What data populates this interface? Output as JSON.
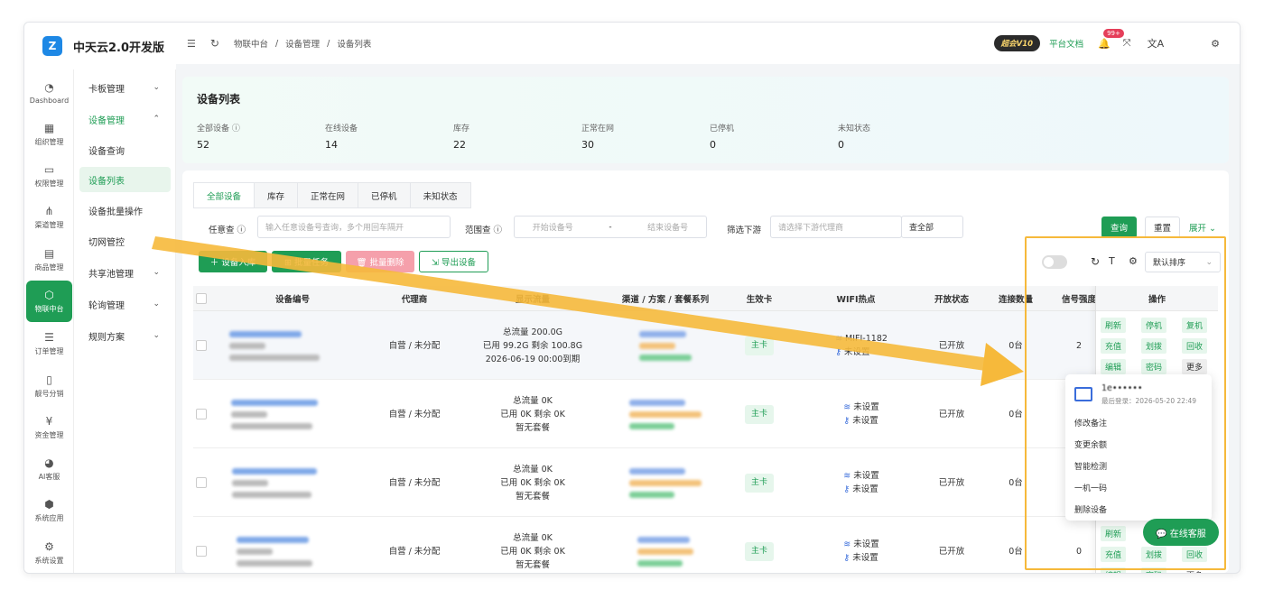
{
  "app": {
    "title": "中天云2.0开发版",
    "logo": "Z"
  },
  "rail": [
    {
      "icon": "◔",
      "label": "Dashboard"
    },
    {
      "icon": "▦",
      "label": "组织管理"
    },
    {
      "icon": "▭",
      "label": "权限管理"
    },
    {
      "icon": "⋔",
      "label": "渠道管理"
    },
    {
      "icon": "▤",
      "label": "商品管理"
    },
    {
      "icon": "⬡",
      "label": "物联中台"
    },
    {
      "icon": "☰",
      "label": "订单管理"
    },
    {
      "icon": "▯",
      "label": "靓号分销"
    },
    {
      "icon": "¥",
      "label": "资金管理"
    },
    {
      "icon": "◕",
      "label": "AI客服"
    },
    {
      "icon": "⬢",
      "label": "系统应用"
    },
    {
      "icon": "⚙",
      "label": "系统设置"
    }
  ],
  "submenu": [
    {
      "label": "卡板管理",
      "chev": "⌄"
    },
    {
      "label": "设备管理",
      "chev": "⌃"
    },
    {
      "label": "设备查询",
      "chev": ""
    },
    {
      "label": "设备列表",
      "chev": ""
    },
    {
      "label": "设备批量操作",
      "chev": ""
    },
    {
      "label": "切网管控",
      "chev": ""
    },
    {
      "label": "共享池管理",
      "chev": "⌄"
    },
    {
      "label": "轮询管理",
      "chev": "⌄"
    },
    {
      "label": "规则方案",
      "chev": "⌄"
    }
  ],
  "breadcrumb": [
    "物联中台",
    "/",
    "设备管理",
    "/",
    "设备列表"
  ],
  "topbar": {
    "vip": "超会V10",
    "docs": "平台文档",
    "badge": "99+"
  },
  "stats": {
    "title": "设备列表",
    "items": [
      {
        "label": "全部设备 ⓘ",
        "value": "52"
      },
      {
        "label": "在线设备",
        "value": "14"
      },
      {
        "label": "库存",
        "value": "22"
      },
      {
        "label": "正常在网",
        "value": "30"
      },
      {
        "label": "已停机",
        "value": "0"
      },
      {
        "label": "未知状态",
        "value": "0"
      }
    ]
  },
  "tabs": [
    "全部设备",
    "库存",
    "正常在网",
    "已停机",
    "未知状态"
  ],
  "filters": {
    "any_label": "任意查 ⓘ",
    "any_placeholder": "输入任意设备号查询，多个用回车隔开",
    "range_label": "范围查 ⓘ",
    "range_start": "开始设备号",
    "range_sep": "-",
    "range_end": "结束设备号",
    "downstream_label": "筛选下游",
    "downstream_placeholder": "请选择下游代理商",
    "scope": "查全部",
    "query": "查询",
    "reset": "重置",
    "expand": "展开 ⌄"
  },
  "actions": {
    "add": "＋ 设备入库",
    "batch": "⊞ 批量任务",
    "delete": "🗑 批量删除",
    "export": "⇲ 导出设备"
  },
  "table_tools": {
    "sort": "默认排序"
  },
  "columns": [
    "设备编号",
    "代理商",
    "显示流量",
    "渠道 / 方案 / 套餐系列",
    "生效卡",
    "WIFI热点",
    "开放状态",
    "连接数量",
    "信号强度",
    "操作"
  ],
  "rows": [
    {
      "agent": "自营 / 未分配",
      "flow": [
        "总流量 200.0G",
        "已用 99.2G   剩余 100.8G",
        "2026-06-19 00:00到期"
      ],
      "card": "主卡",
      "wifi": [
        "MIFI-1182",
        "未设置"
      ],
      "open": "已开放",
      "conn": "0台",
      "signal": "2"
    },
    {
      "agent": "自营 / 未分配",
      "flow": [
        "总流量 0K",
        "已用 0K   剩余 0K",
        "暂无套餐"
      ],
      "card": "主卡",
      "wifi": [
        "未设置",
        "未设置"
      ],
      "open": "已开放",
      "conn": "0台",
      "signal": ""
    },
    {
      "agent": "自营 / 未分配",
      "flow": [
        "总流量 0K",
        "已用 0K   剩余 0K",
        "暂无套餐"
      ],
      "card": "主卡",
      "wifi": [
        "未设置",
        "未设置"
      ],
      "open": "已开放",
      "conn": "0台",
      "signal": ""
    },
    {
      "agent": "自营 / 未分配",
      "flow": [
        "总流量 0K",
        "已用 0K   剩余 0K",
        "暂无套餐"
      ],
      "card": "主卡",
      "wifi": [
        "未设置",
        "未设置"
      ],
      "open": "已开放",
      "conn": "0台",
      "signal": "0"
    }
  ],
  "ops": [
    "刷新",
    "停机",
    "复机",
    "充值",
    "划拨",
    "回收",
    "编辑",
    "密码",
    "更多"
  ],
  "popup": {
    "title": "1e••••••",
    "last_login": "最后登录：2026-05-20 22:49",
    "items": [
      "修改备注",
      "变更余额",
      "智能检测",
      "一机一码",
      "删除设备"
    ]
  },
  "chat": "💬 在线客服",
  "colors": {
    "primary": "#1f9d55",
    "highlight": "#f6b93b"
  }
}
